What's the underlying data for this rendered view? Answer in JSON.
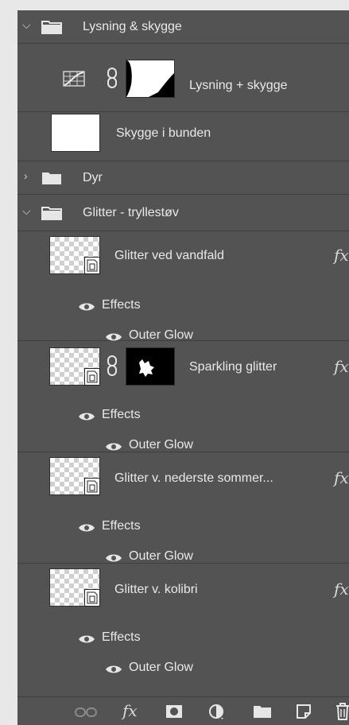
{
  "layers": [
    {
      "name": "Lysning & skygge",
      "type": "group",
      "expanded": true
    },
    {
      "name": "Lysning + skygge",
      "type": "adjustment"
    },
    {
      "name": "Skygge i bunden",
      "type": "pixel"
    },
    {
      "name": "Dyr",
      "type": "group",
      "expanded": false
    },
    {
      "name": "Glitter - tryllestøv",
      "type": "group",
      "expanded": true
    },
    {
      "name": "Glitter ved vandfald",
      "type": "smart",
      "fx": "fx",
      "effects_label": "Effects",
      "effect": "Outer Glow"
    },
    {
      "name": "Sparkling glitter",
      "type": "smart-masked",
      "fx": "fx",
      "effects_label": "Effects",
      "effect": "Outer Glow"
    },
    {
      "name": "Glitter v. nederste sommer...",
      "type": "smart",
      "fx": "fx",
      "effects_label": "Effects",
      "effect": "Outer Glow"
    },
    {
      "name": "Glitter v. kolibri",
      "type": "smart",
      "fx": "fx",
      "effects_label": "Effects",
      "effect": "Outer Glow"
    }
  ],
  "bottom_bar": {
    "fx_label": "fx",
    "icons": [
      "link-layers-icon",
      "fx-icon",
      "add-mask-icon",
      "adjustment-layer-icon",
      "new-group-icon",
      "new-layer-icon",
      "delete-icon"
    ]
  },
  "colors": {
    "panel_bg": "#535353",
    "divider": "#3f3f3f",
    "text": "#e9e9e9"
  }
}
